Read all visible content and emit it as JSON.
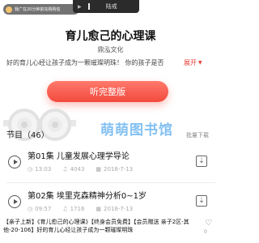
{
  "top": {
    "promo_text": "我广在20分钟前充购购信",
    "tab_text": "陆戒"
  },
  "course": {
    "title": "育儿愈己的心理课",
    "author": "鼎泓文化",
    "description": "好的育儿心经让孩子成为一颗璀璨明珠！ 你的孩子是否",
    "expand_label": "展开"
  },
  "listen_button": {
    "label": "听完整版"
  },
  "watermark": "萌萌图书馆",
  "section": {
    "title": "节目（46）",
    "batch_label": "批量下载"
  },
  "episodes": [
    {
      "title": "第01集 儿童发展心理学导论",
      "duration": "13:03",
      "plays": "4043",
      "date": "2018-7-13"
    },
    {
      "title": "第02集 埃里克森精神分析0~1岁",
      "duration": "09:57",
      "plays": "1716",
      "date": "2018-7-13"
    }
  ],
  "caption": "【亲子上新】《育儿愈己的心理课》【终身会员免费】【会员赠送 亲子2区-其他-20-106】好的育儿心经让孩子成为一颗璀璨明珠",
  "like_count": "0",
  "colors": {
    "accent": "#f24a3d",
    "watermark": "#1f8de8"
  },
  "icons": [
    "play-icon",
    "clock-icon",
    "headphone-icon",
    "calendar-icon",
    "download-icon",
    "like-icon"
  ]
}
